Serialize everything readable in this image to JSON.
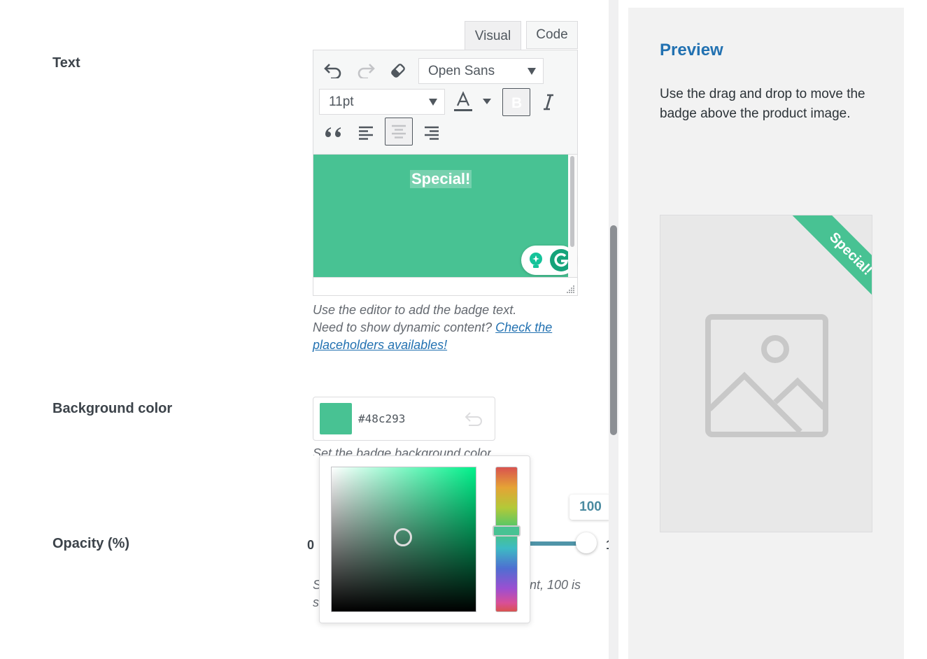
{
  "text_field": {
    "label": "Text",
    "tabs": [
      "Visual",
      "Code"
    ],
    "font_family": "Open Sans",
    "font_size": "11pt",
    "content": "Special!",
    "help_line1": "Use the editor to add the badge text.",
    "help_line2": "Need to show dynamic content?",
    "help_link": "Check the placeholders availables!"
  },
  "background": {
    "label": "Background color",
    "hex": "#48c293",
    "help": "Set the badge background color"
  },
  "opacity": {
    "label": "Opacity (%)",
    "min": "0",
    "max_partial": "1",
    "value": "100",
    "help_tail": "nt, 100 is",
    "help_head": "S",
    "help_head2": "s"
  },
  "preview": {
    "title": "Preview",
    "description": "Use the drag and drop to move the badge above the product image.",
    "badge_text": "Special!"
  },
  "colors": {
    "accent": "#48c293",
    "link": "#2271b1",
    "slider": "#4f94a8"
  }
}
